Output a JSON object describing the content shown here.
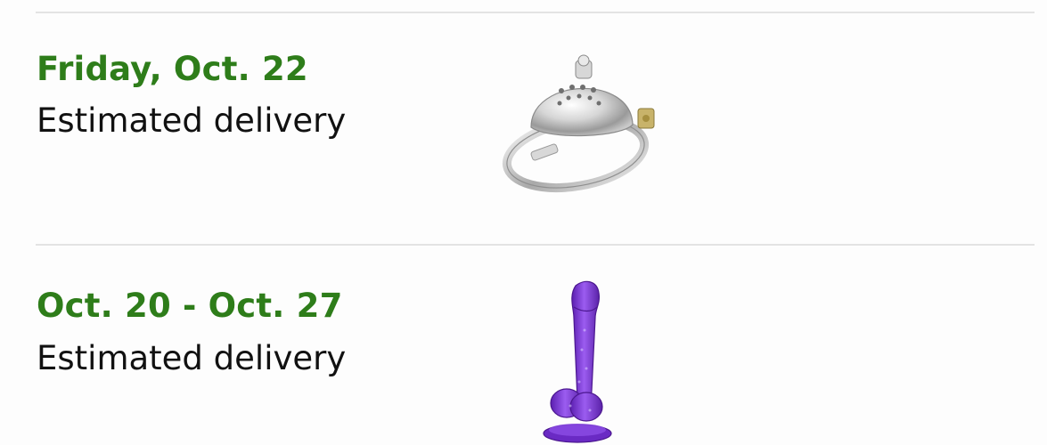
{
  "orders": [
    {
      "date": "Friday, Oct. 22",
      "status": "Estimated delivery",
      "image": "metal-ring-product-image"
    },
    {
      "date": "Oct. 20 - Oct. 27",
      "status": "Estimated delivery",
      "image": "purple-silicone-product-image"
    }
  ],
  "colors": {
    "date": "#2e7d1a",
    "text": "#111111",
    "divider": "#e3e3e3",
    "purple": "#7b2fd6"
  }
}
